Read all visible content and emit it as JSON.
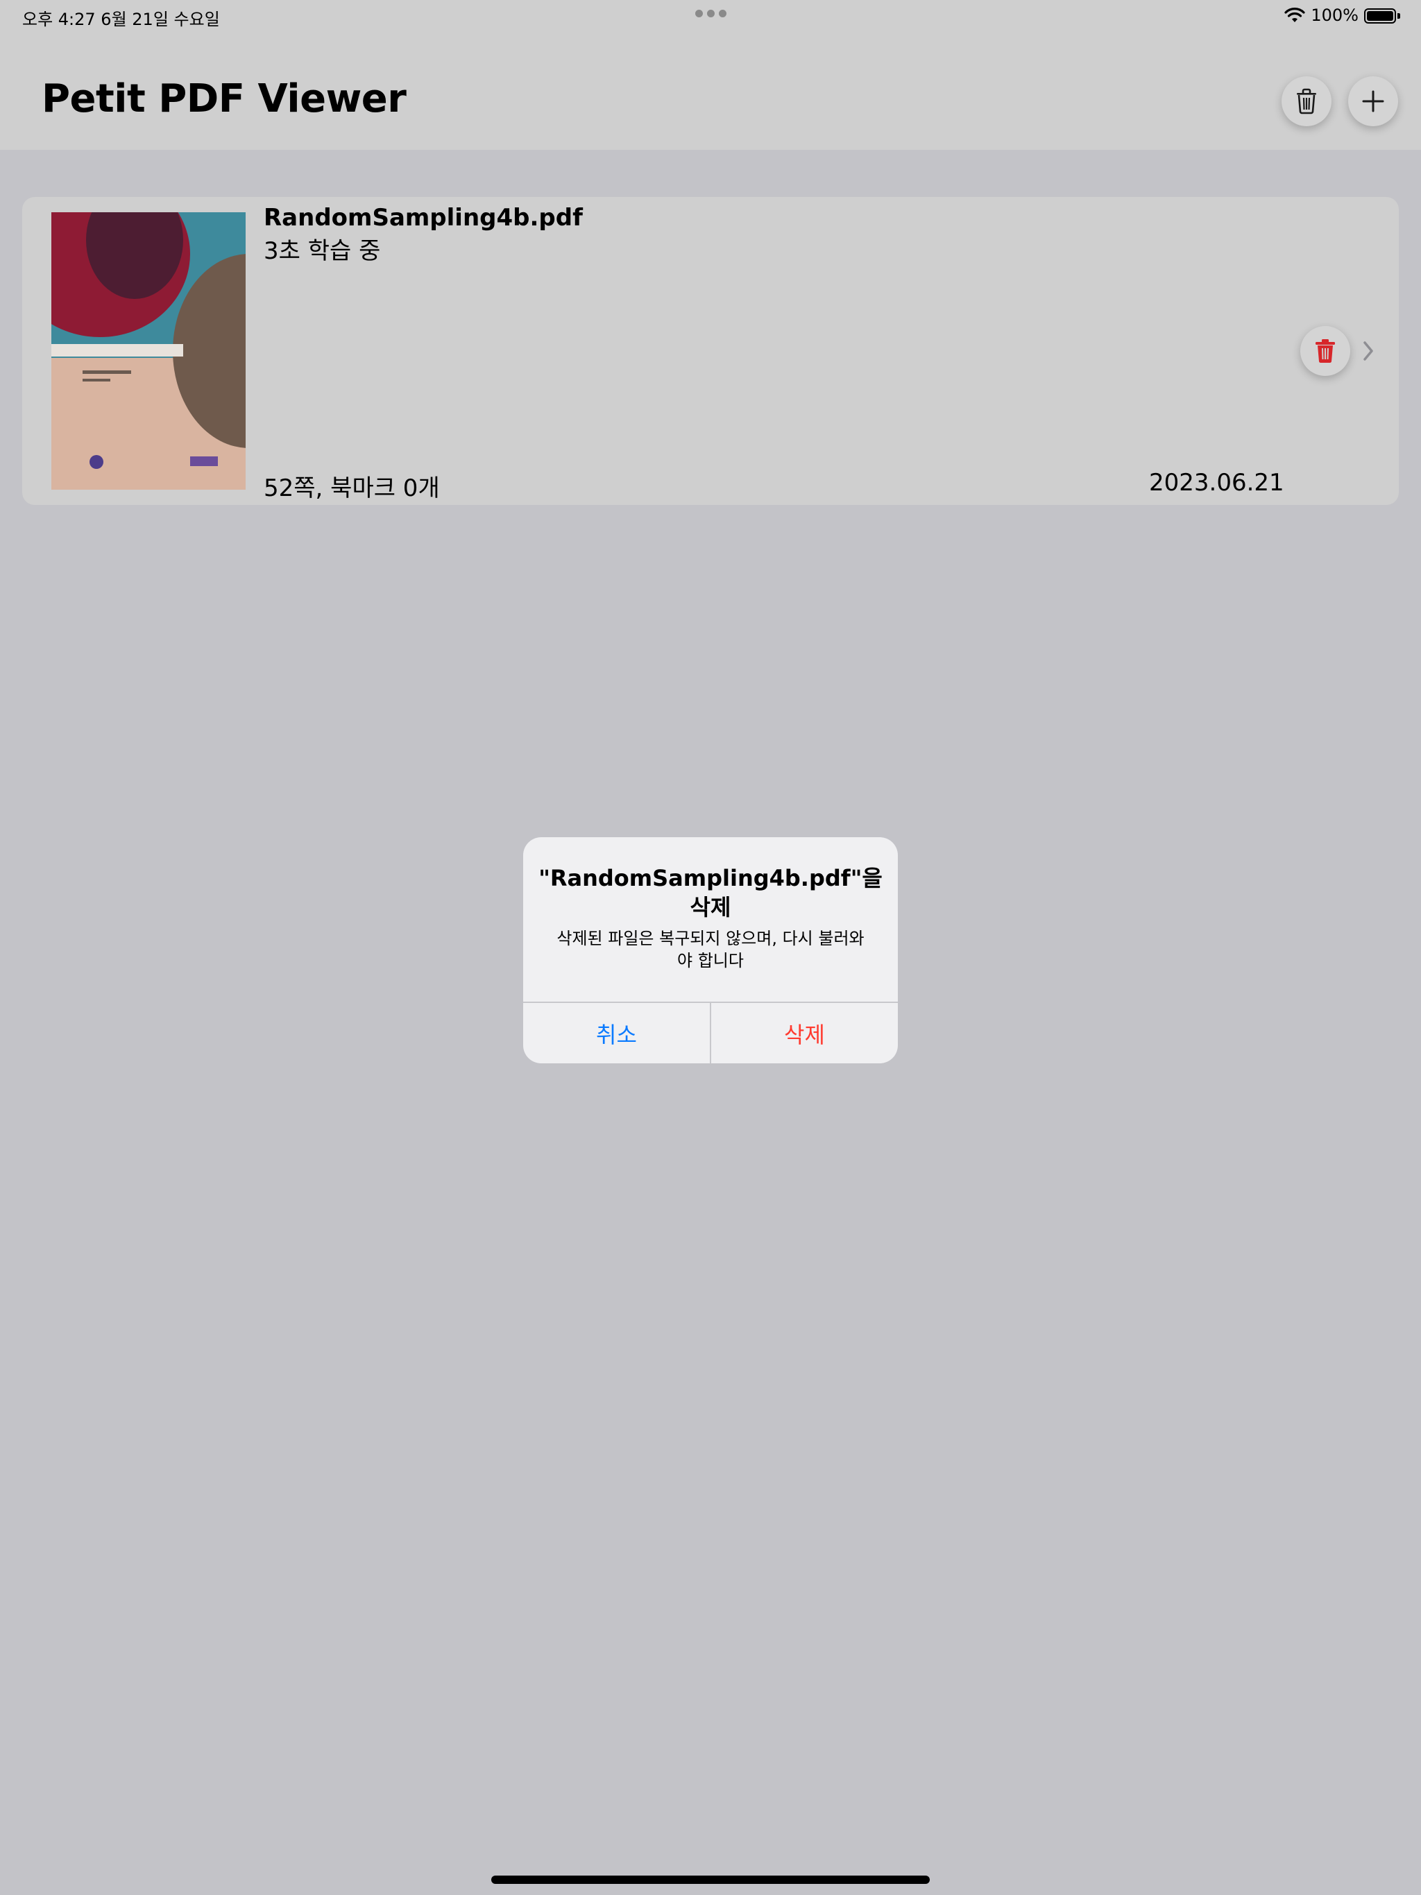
{
  "status_bar": {
    "time_date": "오후 4:27   6월 21일 수요일",
    "battery_percent": "100%"
  },
  "nav": {
    "title": "Petit PDF Viewer",
    "trash_icon": "trash-icon",
    "add_icon": "plus-icon"
  },
  "file": {
    "name": "RandomSampling4b.pdf",
    "status": "3초 학습 중",
    "meta": "52쪽, 북마크 0개",
    "date": "2023.06.21"
  },
  "alert": {
    "title": "\"RandomSampling4b.pdf\"을 삭제",
    "message": "삭제된 파일은 복구되지 않으며, 다시 불러와야 합니다",
    "cancel_label": "취소",
    "delete_label": "삭제"
  },
  "colors": {
    "accent_blue": "#0a7aff",
    "destructive_red": "#ff3b30",
    "row_trash_red": "#d7262a"
  }
}
